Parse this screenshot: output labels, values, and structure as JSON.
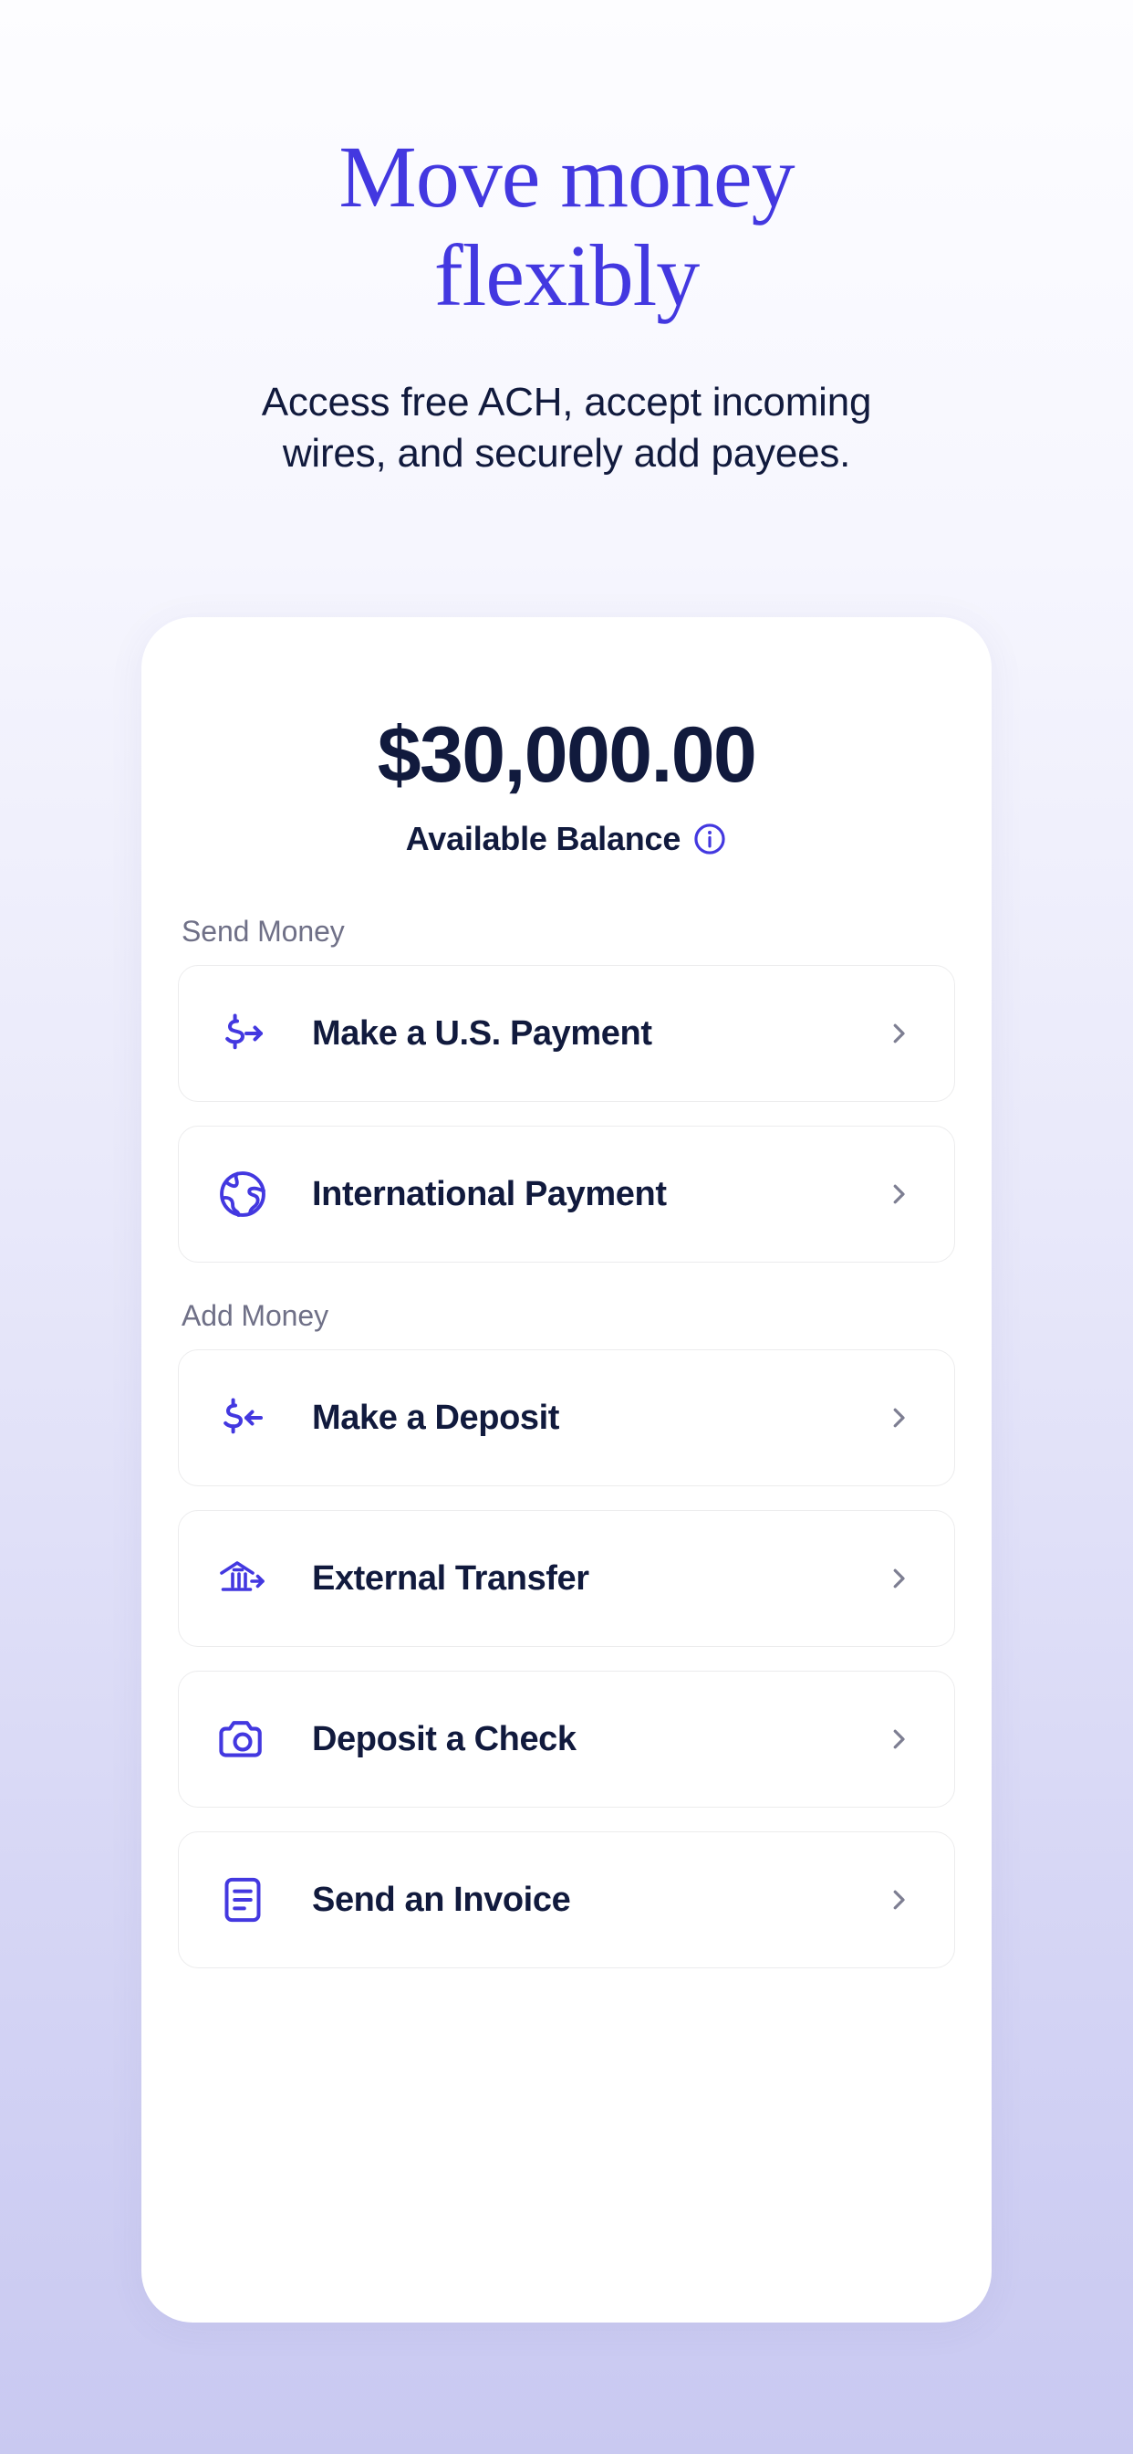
{
  "hero": {
    "title_line1": "Move money",
    "title_line2": "flexibly",
    "subtitle_line1": "Access free ACH, accept incoming",
    "subtitle_line2": "wires, and securely add payees."
  },
  "balance": {
    "amount": "$30,000.00",
    "label": "Available Balance",
    "info_icon": "info-circle-icon"
  },
  "sections": [
    {
      "header": "Send Money",
      "items": [
        {
          "label": "Make a U.S. Payment",
          "icon": "dollar-arrow-right-icon"
        },
        {
          "label": "International Payment",
          "icon": "globe-icon"
        }
      ]
    },
    {
      "header": "Add Money",
      "items": [
        {
          "label": "Make a Deposit",
          "icon": "dollar-arrow-left-icon"
        },
        {
          "label": "External Transfer",
          "icon": "bank-arrow-right-icon"
        },
        {
          "label": "Deposit a Check",
          "icon": "camera-icon"
        },
        {
          "label": "Send an Invoice",
          "icon": "invoice-document-icon"
        }
      ]
    }
  ],
  "colors": {
    "accent_indigo": "#4338e0",
    "text_navy": "#111a3d",
    "muted_gray": "#6f7087",
    "chevron_gray": "#7d7e92",
    "card_white": "#ffffff",
    "background_lavender": "#c9c9f1"
  },
  "chevron_icon": "chevron-right-icon"
}
